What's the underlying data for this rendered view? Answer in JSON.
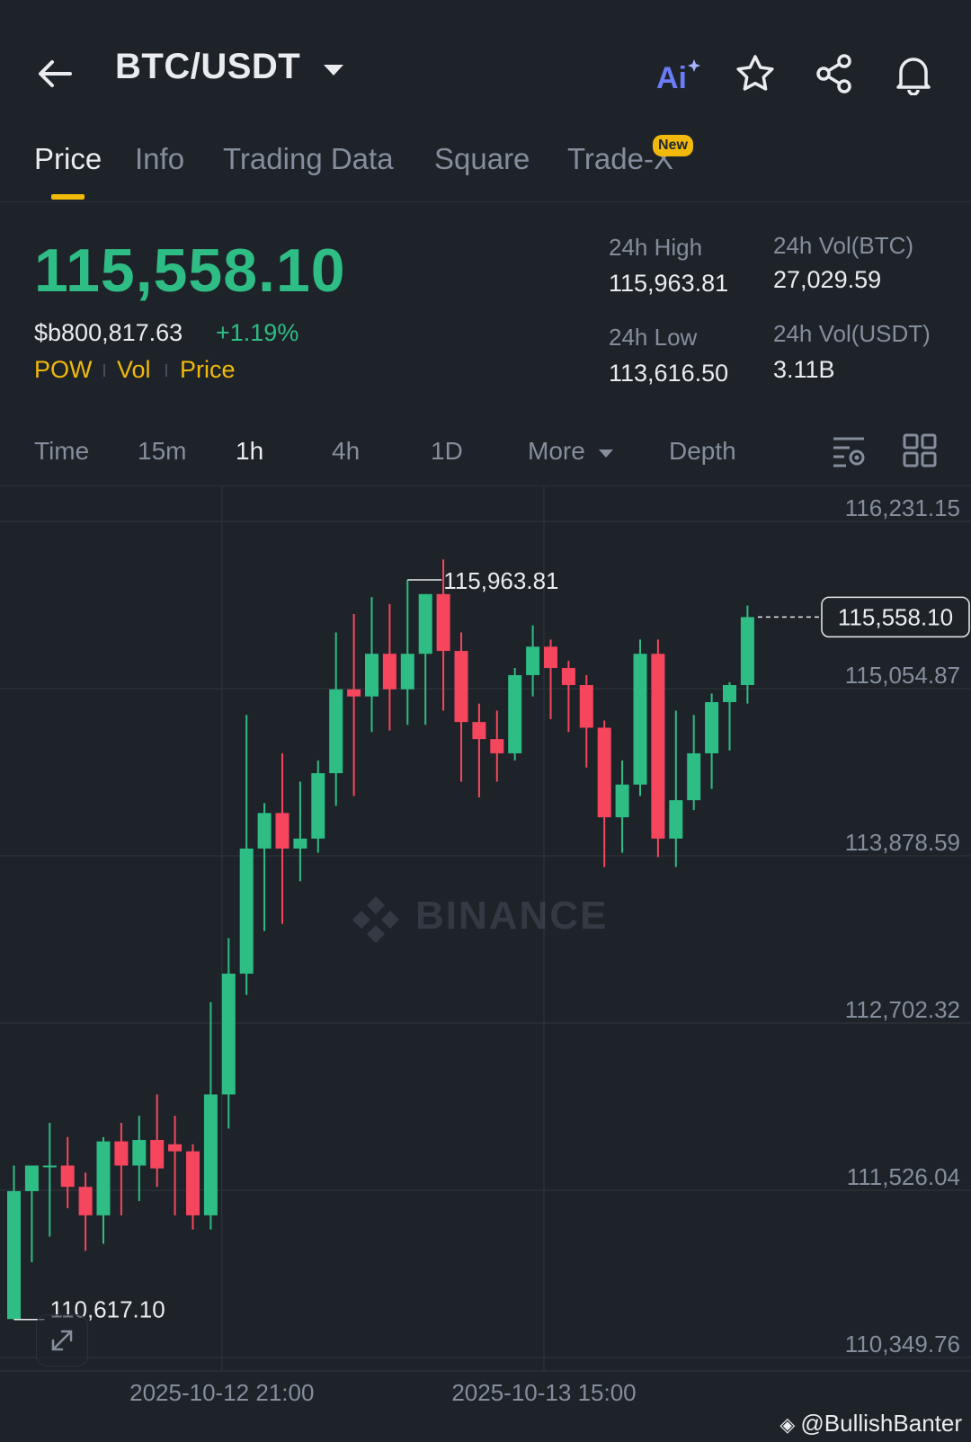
{
  "header": {
    "pair": "BTC/USDT",
    "icons": [
      "back-arrow-icon",
      "ai-icon",
      "star-icon",
      "share-icon",
      "bell-icon"
    ],
    "ai_label": "Ai"
  },
  "tabs": [
    {
      "label": "Price",
      "active": true
    },
    {
      "label": "Info"
    },
    {
      "label": "Trading Data"
    },
    {
      "label": "Square"
    },
    {
      "label": "Trade-X",
      "badge": "New"
    }
  ],
  "ticker": {
    "price": "115,558.10",
    "usd_value": "$b800,817.63",
    "change": "+1.19%",
    "indicators": [
      "POW",
      "Vol",
      "Price"
    ]
  },
  "stats": {
    "high_label": "24h High",
    "high": "115,963.81",
    "low_label": "24h Low",
    "low": "113,616.50",
    "vol_btc_label": "24h Vol(BTC)",
    "vol_btc": "27,029.59",
    "vol_usdt_label": "24h Vol(USDT)",
    "vol_usdt": "3.11B"
  },
  "intervals": [
    {
      "label": "Time"
    },
    {
      "label": "15m"
    },
    {
      "label": "1h",
      "active": true
    },
    {
      "label": "4h"
    },
    {
      "label": "1D"
    },
    {
      "label": "More"
    },
    {
      "label": "Depth"
    }
  ],
  "watermark": "BINANCE",
  "footer": {
    "handle": "@BullishBanter"
  },
  "colors": {
    "up": "#2ebd85",
    "down": "#f6465d",
    "accent": "#f0b90b",
    "bg": "#1e2329",
    "text_dim": "#848e9c"
  },
  "chart_data": {
    "type": "candlestick",
    "y_ticks": [
      "116,231.15",
      "115,054.87",
      "113,878.59",
      "112,702.32",
      "111,526.04",
      "110,349.76"
    ],
    "ylim": [
      110349.76,
      116231.15
    ],
    "x_ticks": [
      {
        "label": "2025-10-12 21:00",
        "index": 12
      },
      {
        "label": "2025-10-13 15:00",
        "index": 30
      }
    ],
    "last_price": "115,558.10",
    "last_price_value": 115558.1,
    "max_label": "115,963.81",
    "max_index": 22,
    "min_label": "110,617.10",
    "min_index": 0,
    "candles": [
      {
        "o": 110620,
        "h": 111700,
        "l": 110617.1,
        "c": 111520
      },
      {
        "o": 111520,
        "h": 111700,
        "l": 111020,
        "c": 111700
      },
      {
        "o": 111700,
        "h": 112000,
        "l": 111200,
        "c": 111700
      },
      {
        "o": 111700,
        "h": 111900,
        "l": 111400,
        "c": 111550
      },
      {
        "o": 111550,
        "h": 111650,
        "l": 111100,
        "c": 111350
      },
      {
        "o": 111350,
        "h": 111900,
        "l": 111150,
        "c": 111870
      },
      {
        "o": 111870,
        "h": 112000,
        "l": 111350,
        "c": 111700
      },
      {
        "o": 111700,
        "h": 112050,
        "l": 111450,
        "c": 111880
      },
      {
        "o": 111880,
        "h": 112200,
        "l": 111550,
        "c": 111680
      },
      {
        "o": 111850,
        "h": 112050,
        "l": 111350,
        "c": 111800
      },
      {
        "o": 111800,
        "h": 111850,
        "l": 111250,
        "c": 111350
      },
      {
        "o": 111350,
        "h": 112850,
        "l": 111250,
        "c": 112200
      },
      {
        "o": 112200,
        "h": 113300,
        "l": 111960,
        "c": 113050
      },
      {
        "o": 113050,
        "h": 114870,
        "l": 112900,
        "c": 113930
      },
      {
        "o": 113930,
        "h": 114250,
        "l": 113350,
        "c": 114180
      },
      {
        "o": 114180,
        "h": 114600,
        "l": 113400,
        "c": 113930
      },
      {
        "o": 113930,
        "h": 114400,
        "l": 113700,
        "c": 114000
      },
      {
        "o": 114000,
        "h": 114550,
        "l": 113900,
        "c": 114460
      },
      {
        "o": 114460,
        "h": 115450,
        "l": 114230,
        "c": 115050
      },
      {
        "o": 115050,
        "h": 115580,
        "l": 114300,
        "c": 115000
      },
      {
        "o": 115000,
        "h": 115700,
        "l": 114750,
        "c": 115300
      },
      {
        "o": 115300,
        "h": 115650,
        "l": 114760,
        "c": 115050
      },
      {
        "o": 115050,
        "h": 115820,
        "l": 114800,
        "c": 115300
      },
      {
        "o": 115300,
        "h": 115720,
        "l": 114800,
        "c": 115720
      },
      {
        "o": 115720,
        "h": 115963.81,
        "l": 114900,
        "c": 115320
      },
      {
        "o": 115320,
        "h": 115450,
        "l": 114400,
        "c": 114820
      },
      {
        "o": 114820,
        "h": 114950,
        "l": 114290,
        "c": 114700
      },
      {
        "o": 114700,
        "h": 114900,
        "l": 114400,
        "c": 114600
      },
      {
        "o": 114600,
        "h": 115200,
        "l": 114550,
        "c": 115150
      },
      {
        "o": 115150,
        "h": 115500,
        "l": 115000,
        "c": 115350
      },
      {
        "o": 115350,
        "h": 115400,
        "l": 114840,
        "c": 115200
      },
      {
        "o": 115200,
        "h": 115250,
        "l": 114750,
        "c": 115080
      },
      {
        "o": 115080,
        "h": 115150,
        "l": 114500,
        "c": 114780
      },
      {
        "o": 114780,
        "h": 114830,
        "l": 113800,
        "c": 114150
      },
      {
        "o": 114150,
        "h": 114550,
        "l": 113900,
        "c": 114380
      },
      {
        "o": 114380,
        "h": 115400,
        "l": 114300,
        "c": 115300
      },
      {
        "o": 115300,
        "h": 115400,
        "l": 113870,
        "c": 114000
      },
      {
        "o": 114000,
        "h": 114900,
        "l": 113800,
        "c": 114270
      },
      {
        "o": 114270,
        "h": 114870,
        "l": 114200,
        "c": 114600
      },
      {
        "o": 114600,
        "h": 115020,
        "l": 114350,
        "c": 114960
      },
      {
        "o": 114960,
        "h": 115100,
        "l": 114620,
        "c": 115080
      },
      {
        "o": 115080,
        "h": 115640,
        "l": 114950,
        "c": 115558.1
      }
    ]
  }
}
